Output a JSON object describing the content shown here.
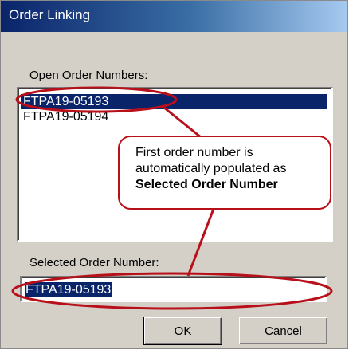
{
  "window": {
    "title": "Order Linking"
  },
  "open_orders": {
    "label": "Open Order Numbers:",
    "items": [
      "FTPA19-05193",
      "FTPA19-05194"
    ],
    "selected_index": 0
  },
  "selected_order": {
    "label": "Selected Order Number:",
    "value": "FTPA19-05193"
  },
  "buttons": {
    "ok": "OK",
    "cancel": "Cancel"
  },
  "callout": {
    "line1": "First order number is",
    "line2": "automatically populated as",
    "line3": "Selected Order Number"
  },
  "colors": {
    "annotation": "#b8101a",
    "selection": "#0a246a"
  }
}
